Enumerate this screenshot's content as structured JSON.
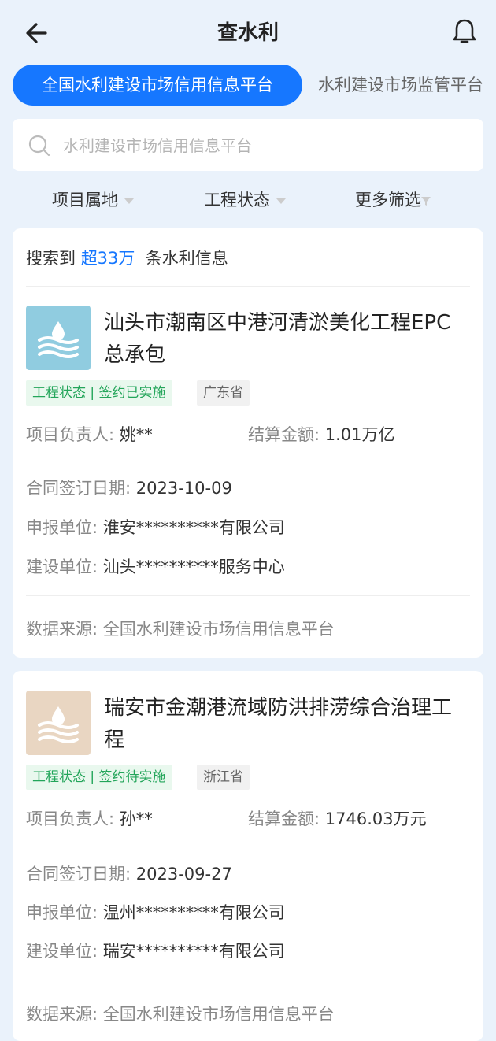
{
  "header": {
    "title": "查水利",
    "back_icon": "arrow-left-icon",
    "bell_icon": "bell-icon"
  },
  "tabs": [
    {
      "label": "全国水利建设市场信用信息平台",
      "active": true
    },
    {
      "label": "水利建设市场监管平台",
      "active": false
    }
  ],
  "search": {
    "placeholder": "水利建设市场信用信息平台",
    "value": ""
  },
  "filters": [
    {
      "label": "项目属地"
    },
    {
      "label": "工程状态"
    },
    {
      "label": "更多筛选"
    }
  ],
  "results": {
    "prefix": "搜索到",
    "count": "超33万",
    "suffix": "条水利信息"
  },
  "items": [
    {
      "title": "汕头市潮南区中港河清淤美化工程EPC总承包",
      "status_tag": "工程状态 | 签约已实施",
      "region_tag": "广东省",
      "leader_label": "项目负责人:",
      "leader": "姚**",
      "amount_label": "结算金额:",
      "amount": "1.01万亿",
      "date_label": "合同签订日期:",
      "date": "2023-10-09",
      "applicant_label": "申报单位:",
      "applicant": "淮安**********有限公司",
      "builder_label": "建设单位:",
      "builder": "汕头**********服务中心",
      "source_label": "数据来源:",
      "source": "全国水利建设市场信用信息平台",
      "icon_color": "#90cce0"
    },
    {
      "title": "瑞安市金潮港流域防洪排涝综合治理工程",
      "status_tag": "工程状态 | 签约待实施",
      "region_tag": "浙江省",
      "leader_label": "项目负责人:",
      "leader": "孙**",
      "amount_label": "结算金额:",
      "amount": "1746.03万元",
      "date_label": "合同签订日期:",
      "date": "2023-09-27",
      "applicant_label": "申报单位:",
      "applicant": "温州**********有限公司",
      "builder_label": "建设单位:",
      "builder": "瑞安**********有限公司",
      "source_label": "数据来源:",
      "source": "全国水利建设市场信用信息平台",
      "icon_color": "#e9d6c2"
    }
  ],
  "colors": {
    "accent": "#1677ff",
    "status_green": "#23a55a",
    "background": "#eaf2fb"
  }
}
